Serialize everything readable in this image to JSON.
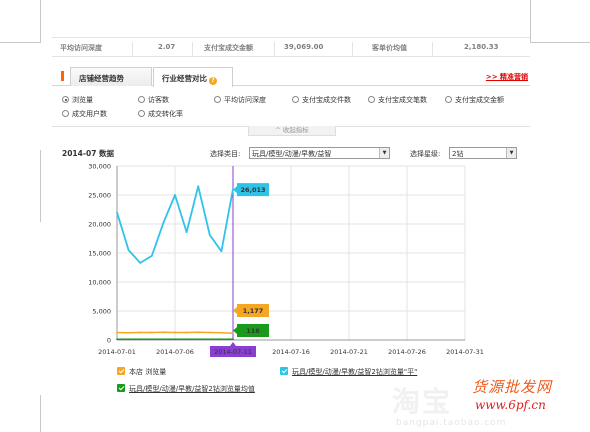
{
  "top_row": {
    "cells": [
      "平均访问深度",
      "2.07",
      "支付宝成交金额",
      "39,069.00",
      "客单价均值",
      "2,180.33"
    ]
  },
  "tabs": [
    {
      "label": "店铺经营趋势",
      "active": false
    },
    {
      "label": "行业经营对比",
      "active": true
    }
  ],
  "help_glyph": "?",
  "right_link": ">> 精准营销",
  "metrics": [
    {
      "label": "浏览量",
      "selected": true
    },
    {
      "label": "访客数",
      "selected": false
    },
    {
      "label": "平均访问深度",
      "selected": false
    },
    {
      "label": "支付宝成交件数",
      "selected": false
    },
    {
      "label": "支付宝成交笔数",
      "selected": false
    },
    {
      "label": "支付宝成交金额",
      "selected": false
    },
    {
      "label": "成交用户数",
      "selected": false
    },
    {
      "label": "成交转化率",
      "selected": false
    }
  ],
  "collapse_label": "^ 收起指标",
  "filter": {
    "date_title": "2014-07 数据",
    "category_label": "选择类目:",
    "category_value": "玩具/模型/动漫/早教/益智",
    "star_label": "选择星级:",
    "star_value": "2钻",
    "dropdown_glyph": "▼"
  },
  "chart_data": {
    "type": "line",
    "x": [
      "2014-07-01",
      "2014-07-02",
      "2014-07-03",
      "2014-07-04",
      "2014-07-05",
      "2014-07-06",
      "2014-07-07",
      "2014-07-08",
      "2014-07-09",
      "2014-07-10",
      "2014-07-11"
    ],
    "x_ticks": [
      "2014-07-01",
      "2014-07-06",
      "2014-07-11",
      "2014-07-16",
      "2014-07-21",
      "2014-07-26",
      "2014-07-31"
    ],
    "x_range": [
      "2014-07-01",
      "2014-07-31"
    ],
    "highlight_tick": "2014-07-11",
    "ylim": [
      0,
      30000
    ],
    "y_ticks": [
      "0",
      "5,000",
      "10,000",
      "15,000",
      "20,000",
      "25,000",
      "30,000"
    ],
    "grid": true,
    "series": [
      {
        "name": "玩具/模型/动漫/早教/益智2钻浏览量\"平\"",
        "color": "#2ec4e8",
        "values": [
          22000,
          15500,
          13300,
          14500,
          20200,
          25000,
          18600,
          26500,
          18100,
          15300,
          26013
        ]
      },
      {
        "name": "本店 浏览量",
        "color": "#f5a623",
        "values": [
          1300,
          1250,
          1300,
          1300,
          1350,
          1300,
          1300,
          1350,
          1300,
          1250,
          1177
        ]
      },
      {
        "name": "玩具/模型/动漫/早教/益智2钻浏览量均值",
        "color": "#1a9a1a",
        "values": [
          120,
          115,
          118,
          120,
          122,
          118,
          117,
          120,
          118,
          116,
          116
        ]
      }
    ],
    "data_labels": [
      {
        "text": "26,013",
        "color": "#2ec4e8"
      },
      {
        "text": "1,177",
        "color": "#f5a623"
      },
      {
        "text": "116",
        "color": "#1a9a1a"
      }
    ]
  },
  "legend": [
    {
      "label": "本店 浏览量",
      "color": "#f5a623",
      "underline": false
    },
    {
      "label": "玩具/模型/动漫/早教/益智2钻浏览量\"平\"",
      "color": "#2ec4e8",
      "underline": true
    },
    {
      "label": "玩具/模型/动漫/早教/益智2钻浏览量均值",
      "color": "#1a9a1a",
      "underline": true
    }
  ],
  "watermark": {
    "big": "淘宝",
    "small": "bangpai.taobao.com"
  },
  "brand": {
    "line1": "货源批发网",
    "line2": "www.6pf.cn"
  }
}
